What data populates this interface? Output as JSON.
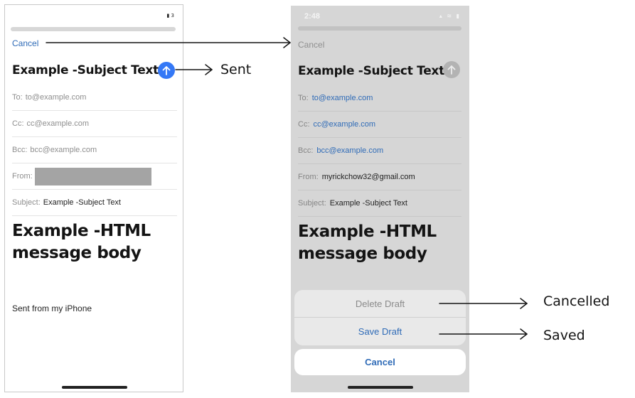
{
  "left_phone": {
    "status_icons": "▮ 3",
    "cancel": "Cancel",
    "subject_title": "Example -Subject Text",
    "send_icon": "↑",
    "to_label": "To:",
    "to_value": "to@example.com",
    "cc_label": "Cc:",
    "cc_value": "cc@example.com",
    "bcc_label": "Bcc:",
    "bcc_value": "bcc@example.com",
    "from_label": "From:",
    "subject_label": "Subject:",
    "subject_value": "Example -Subject Text",
    "body_line1": "Example -HTML",
    "body_line2": "message body",
    "signature": "Sent from my iPhone"
  },
  "right_phone": {
    "time": "2:48",
    "status_icons": "▴ ≋ ▮",
    "cancel": "Cancel",
    "subject_title": "Example -Subject Text",
    "send_icon": "↑",
    "to_label": "To:",
    "to_value": "to@example.com",
    "cc_label": "Cc:",
    "cc_value": "cc@example.com",
    "bcc_label": "Bcc:",
    "bcc_value": "bcc@example.com",
    "from_label": "From:",
    "from_value": "myrickchow32@gmail.com",
    "subject_label": "Subject:",
    "subject_value": "Example -Subject Text",
    "body_line1": "Example -HTML",
    "body_line2": "message body",
    "action_delete": "Delete Draft",
    "action_save": "Save Draft",
    "action_cancel": "Cancel"
  },
  "annotations": {
    "sent": "Sent",
    "cancelled": "Cancelled",
    "saved": "Saved"
  },
  "colors": {
    "accent_blue": "#3478f6",
    "link_blue": "#2f6bb7",
    "dim_overlay": "#d6d6d6"
  }
}
